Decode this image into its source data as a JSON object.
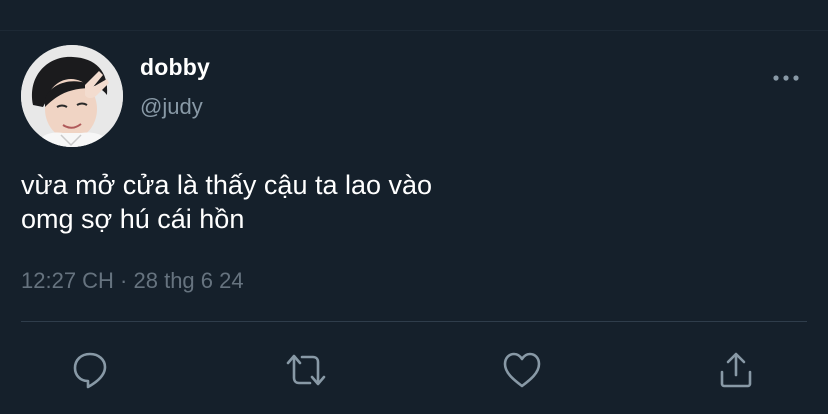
{
  "tweet": {
    "author": {
      "display_name": "dobby",
      "handle": "@judy"
    },
    "text_lines": [
      "vừa mở cửa là thấy cậu ta lao vào",
      "omg sợ hú cái hồn"
    ],
    "timestamp": "12:27 CH · 28 thg 6 24"
  },
  "icons": {
    "more": "more-horizontal-icon",
    "reply": "reply-icon",
    "retweet": "retweet-icon",
    "like": "heart-icon",
    "share": "share-icon"
  },
  "colors": {
    "background": "#15202b",
    "primary_text": "#ffffff",
    "secondary_text": "#8899a6",
    "timestamp_text": "#66737f",
    "icon": "#8899a6",
    "divider": "#2f3d4b"
  }
}
